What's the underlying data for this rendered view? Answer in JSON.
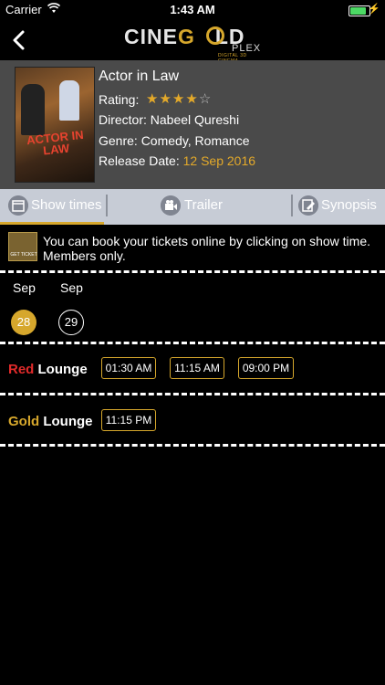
{
  "status_bar": {
    "carrier": "Carrier",
    "time": "1:43 AM",
    "battery_level": 0.9
  },
  "nav": {
    "logo_prefix": "CINE",
    "logo_gold": "G",
    "logo_rest": "LD",
    "logo_plex": "PLEX",
    "logo_sub": "DIGITAL 3D CINEMA"
  },
  "movie": {
    "title": "Actor in Law",
    "poster_title": "ACTOR IN LAW",
    "rating_label": "Rating:",
    "rating": 4,
    "rating_max": 5,
    "director": "Director: Nabeel Qureshi",
    "genre": "Genre: Comedy, Romance",
    "release_label": "Release Date:",
    "release_date": "12 Sep 2016"
  },
  "tabs": [
    {
      "label": "Show times",
      "icon": "calendar-icon",
      "active": true
    },
    {
      "label": "Trailer",
      "icon": "video-camera-icon",
      "active": false
    },
    {
      "label": "Synopsis",
      "icon": "edit-icon",
      "active": false
    }
  ],
  "info": {
    "ticket_label": "GET TICKET",
    "text": "You can book your tickets online by clicking on show time. Members only."
  },
  "dates": [
    {
      "month": "Sep",
      "day": "28",
      "selected": true
    },
    {
      "month": "Sep",
      "day": "29",
      "selected": false
    }
  ],
  "lounges": [
    {
      "name_colored": "Red",
      "name_rest": " Lounge",
      "color": "#e02a2a",
      "times": [
        "01:30 AM",
        "11:15 AM",
        "09:00 PM"
      ]
    },
    {
      "name_colored": "Gold",
      "name_rest": " Lounge",
      "color": "#d6a72c",
      "times": [
        "11:15 PM"
      ]
    }
  ]
}
